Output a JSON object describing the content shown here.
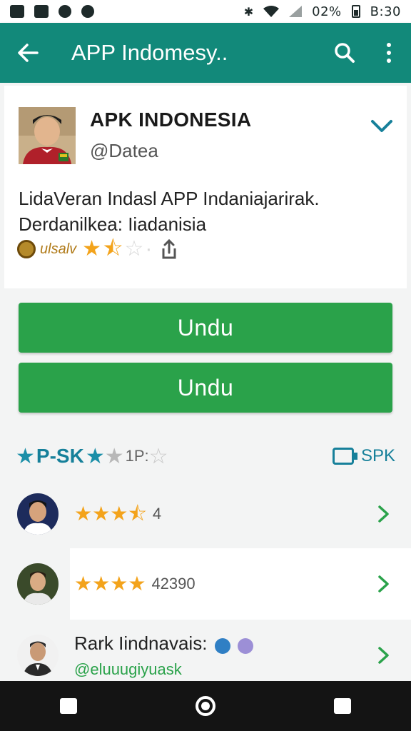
{
  "status_bar": {
    "left_icons": [
      "image-icon",
      "g-icon",
      "chat-icon",
      "minus-circle-icon"
    ],
    "battery_text": "02%",
    "time": "B:30"
  },
  "app_bar": {
    "title": "APP Indomesy..",
    "back_icon": "arrow-left-icon",
    "search_icon": "search-icon",
    "menu_icon": "more-vert-icon",
    "color": "#12897a"
  },
  "app_card": {
    "name": "APK INDONESIA",
    "developer": "@Datea",
    "description_lines": [
      "LidaVeran Indasl APP Indaniajarirak.",
      "Derdanilkea: Iiadanisia"
    ],
    "rating_label": "ulsalv",
    "rating_stars": [
      1,
      0.5,
      0,
      0
    ],
    "share_icon": "share-icon"
  },
  "buttons": {
    "primary_label": "Undu",
    "secondary_label": "Undu",
    "color": "#2aa24a"
  },
  "reviews": {
    "summary_label": "P-SK",
    "summary_stars": [
      1,
      0.5
    ],
    "summary_count": "1P:",
    "apk_link_label": "SPK",
    "items": [
      {
        "stars": [
          1,
          1,
          1,
          0.5
        ],
        "value": "4"
      },
      {
        "stars": [
          1,
          1,
          1,
          1
        ],
        "value": "42390"
      },
      {
        "name": "Rark Iindnavais:",
        "subtitle": "@eluuugiyuask"
      }
    ]
  },
  "nav_bar": {
    "buttons": [
      "back-square-icon",
      "home-circle-icon",
      "recent-square-icon"
    ]
  }
}
